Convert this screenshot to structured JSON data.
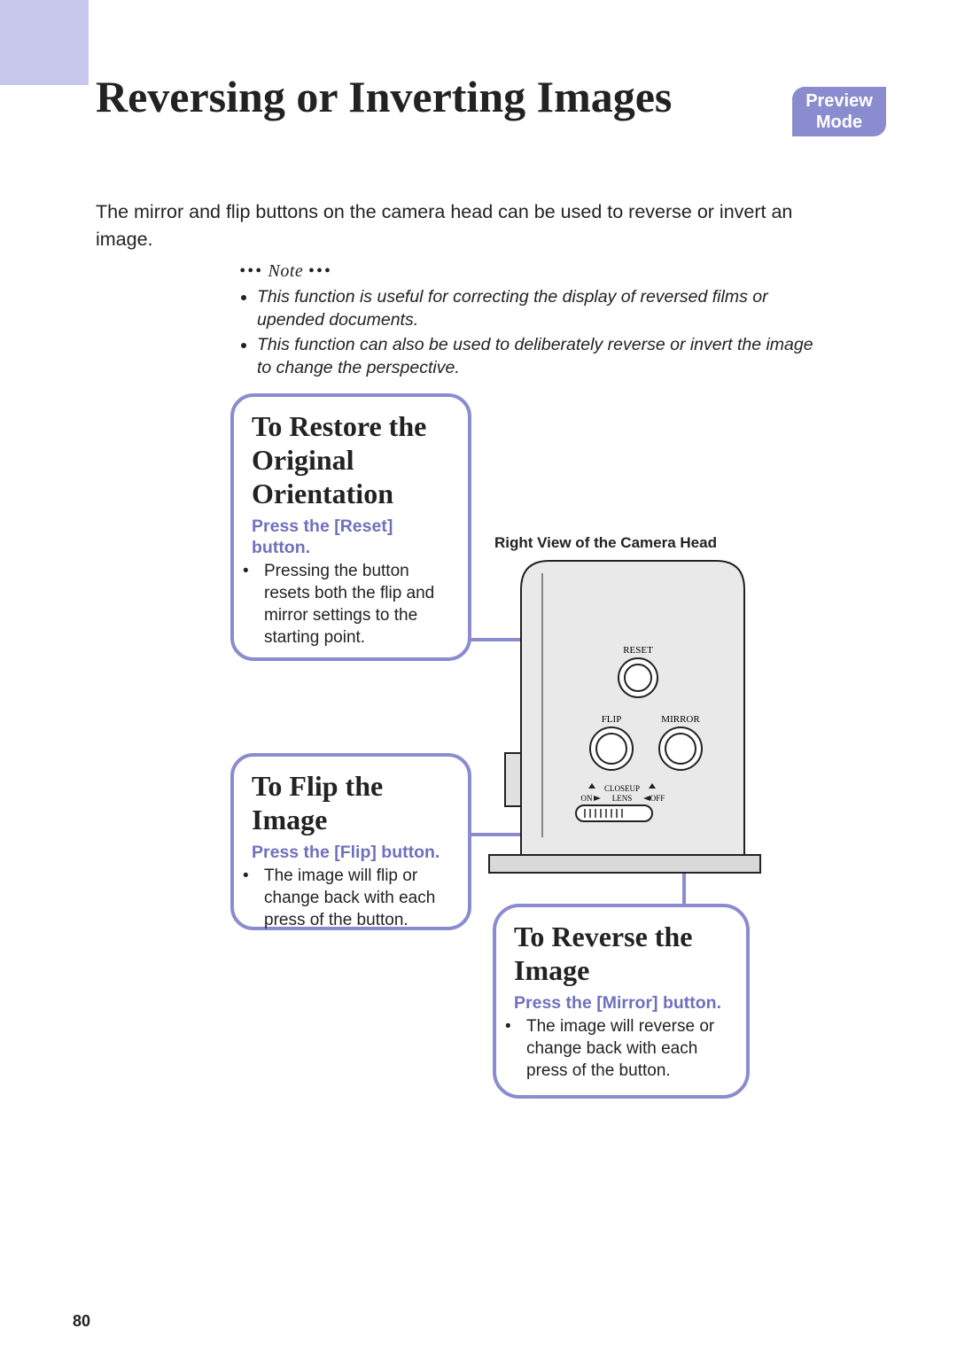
{
  "page_number": "80",
  "badge": {
    "line1": "Preview",
    "line2": "Mode"
  },
  "title": "Reversing or Inverting Images",
  "intro": "The mirror and flip buttons on the camera head can be used to reverse or invert an image.",
  "note": {
    "heading_prefix": "•••",
    "heading_text": "Note",
    "heading_suffix": "•••",
    "items": [
      "This function is useful for correcting the display of reversed films or upended documents.",
      "This function can also be used to deliberately reverse or invert the image to change the perspective."
    ]
  },
  "callout_restore": {
    "title": "To Restore the Original Orientation",
    "subtitle": "Press the [Reset] button.",
    "body": "Pressing the button resets both the flip and mirror settings to the starting point."
  },
  "callout_flip": {
    "title": "To Flip the Image",
    "subtitle": "Press the [Flip] button.",
    "body": "The image will flip or change back with each press of the button."
  },
  "callout_reverse": {
    "title": "To Reverse the Image",
    "subtitle": "Press the [Mirror] button.",
    "body": "The image will reverse or change back with each press of the button."
  },
  "diagram": {
    "caption": "Right View of the Camera Head",
    "labels": {
      "reset": "RESET",
      "flip": "FLIP",
      "mirror": "MIRROR",
      "closeup": "CLOSEUP",
      "lens": "LENS",
      "on": "ON",
      "off": "OFF"
    }
  }
}
